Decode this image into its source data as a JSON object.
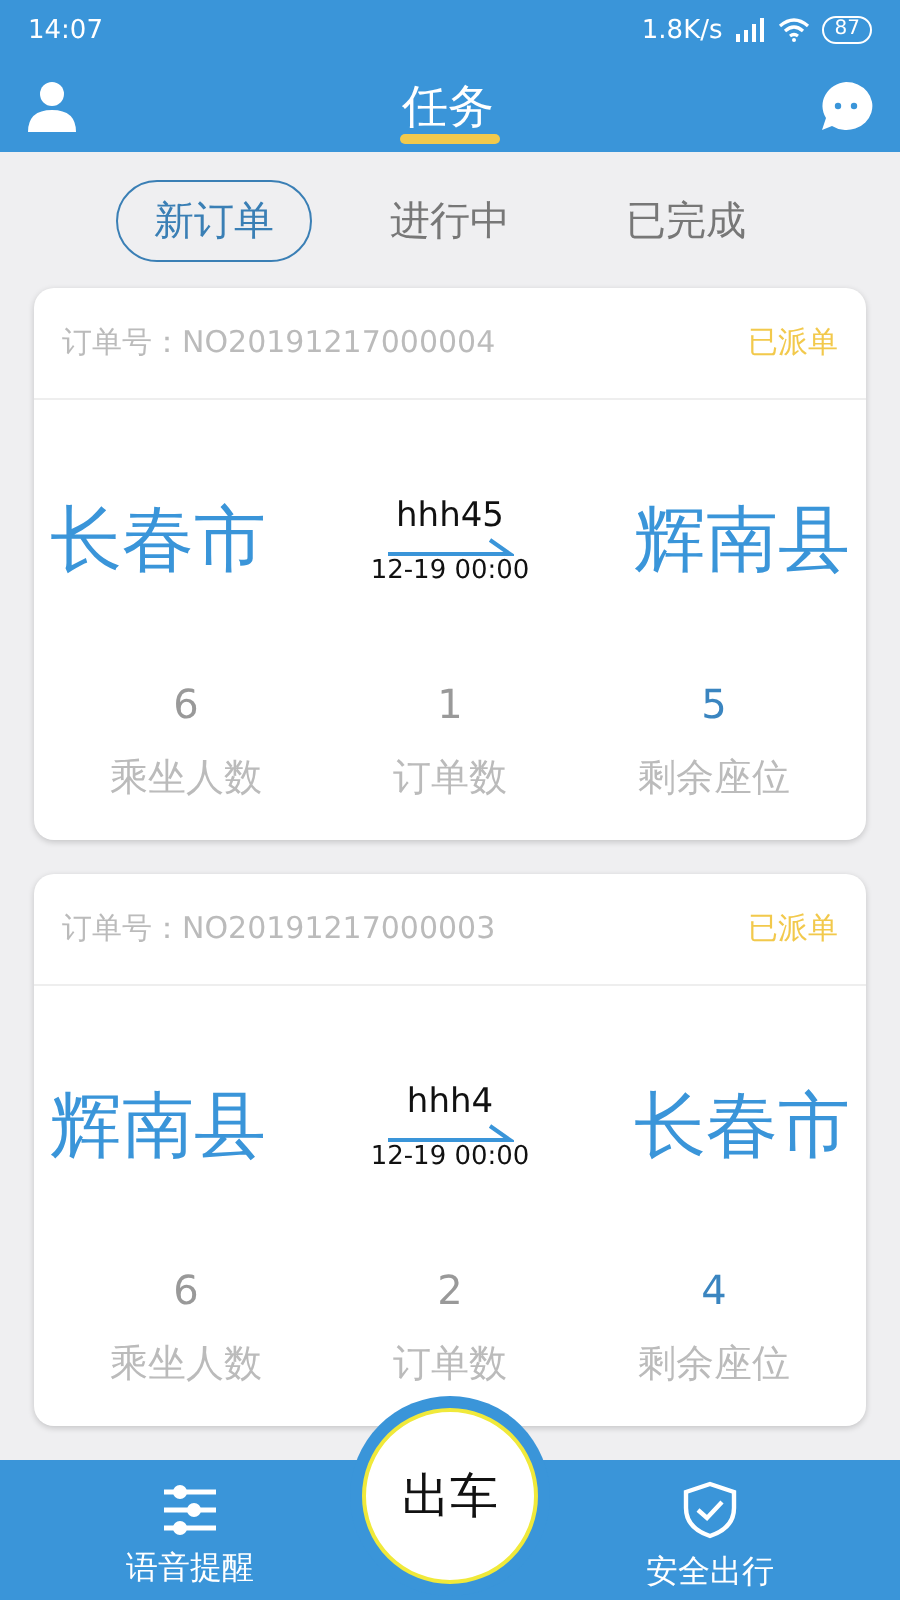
{
  "status_bar": {
    "time": "14:07",
    "speed": "1.8K/s",
    "battery": "87"
  },
  "header": {
    "title": "任务"
  },
  "tabs": [
    {
      "label": "新订单",
      "selected": true
    },
    {
      "label": "进行中",
      "selected": false
    },
    {
      "label": "已完成",
      "selected": false
    }
  ],
  "orders": [
    {
      "order_label": "订单号：NO20191217000004",
      "status": "已派单",
      "from": "长春市",
      "to": "辉南县",
      "route": "hhh45",
      "time": "12-19 00:00",
      "stats": [
        {
          "value": "6",
          "label": "乘坐人数",
          "highlight": false
        },
        {
          "value": "1",
          "label": "订单数",
          "highlight": false
        },
        {
          "value": "5",
          "label": "剩余座位",
          "highlight": true
        }
      ]
    },
    {
      "order_label": "订单号：NO20191217000003",
      "status": "已派单",
      "from": "辉南县",
      "to": "长春市",
      "route": "hhh4",
      "time": "12-19 00:00",
      "stats": [
        {
          "value": "6",
          "label": "乘坐人数",
          "highlight": false
        },
        {
          "value": "2",
          "label": "订单数",
          "highlight": false
        },
        {
          "value": "4",
          "label": "剩余座位",
          "highlight": true
        }
      ]
    }
  ],
  "bottom_nav": {
    "left": "语音提醒",
    "center": "出车",
    "right": "安全出行"
  }
}
